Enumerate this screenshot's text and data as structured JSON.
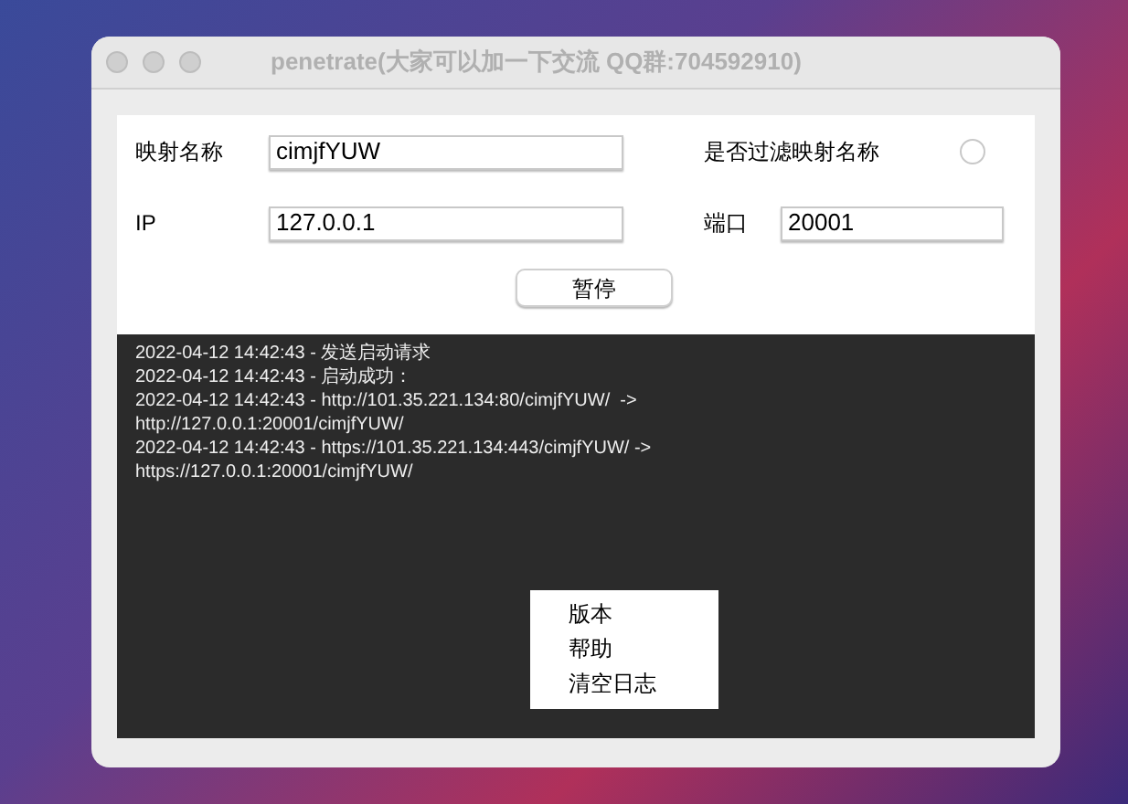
{
  "window": {
    "title": "penetrate(大家可以加一下交流 QQ群:704592910)"
  },
  "form": {
    "mapping_name": {
      "label": "映射名称",
      "value": "cimjfYUW"
    },
    "filter": {
      "label": "是否过滤映射名称",
      "checked": false
    },
    "ip": {
      "label": "IP",
      "value": "127.0.0.1"
    },
    "port": {
      "label": "端口",
      "value": "20001"
    },
    "button": "暂停"
  },
  "log": [
    "2022-04-12 14:42:43 - 发送启动请求",
    "2022-04-12 14:42:43 - 启动成功：",
    "2022-04-12 14:42:43 - http://101.35.221.134:80/cimjfYUW/  ->",
    "http://127.0.0.1:20001/cimjfYUW/",
    "2022-04-12 14:42:43 - https://101.35.221.134:443/cimjfYUW/ ->",
    "https://127.0.0.1:20001/cimjfYUW/"
  ],
  "context_menu": [
    "版本",
    "帮助",
    "清空日志"
  ]
}
